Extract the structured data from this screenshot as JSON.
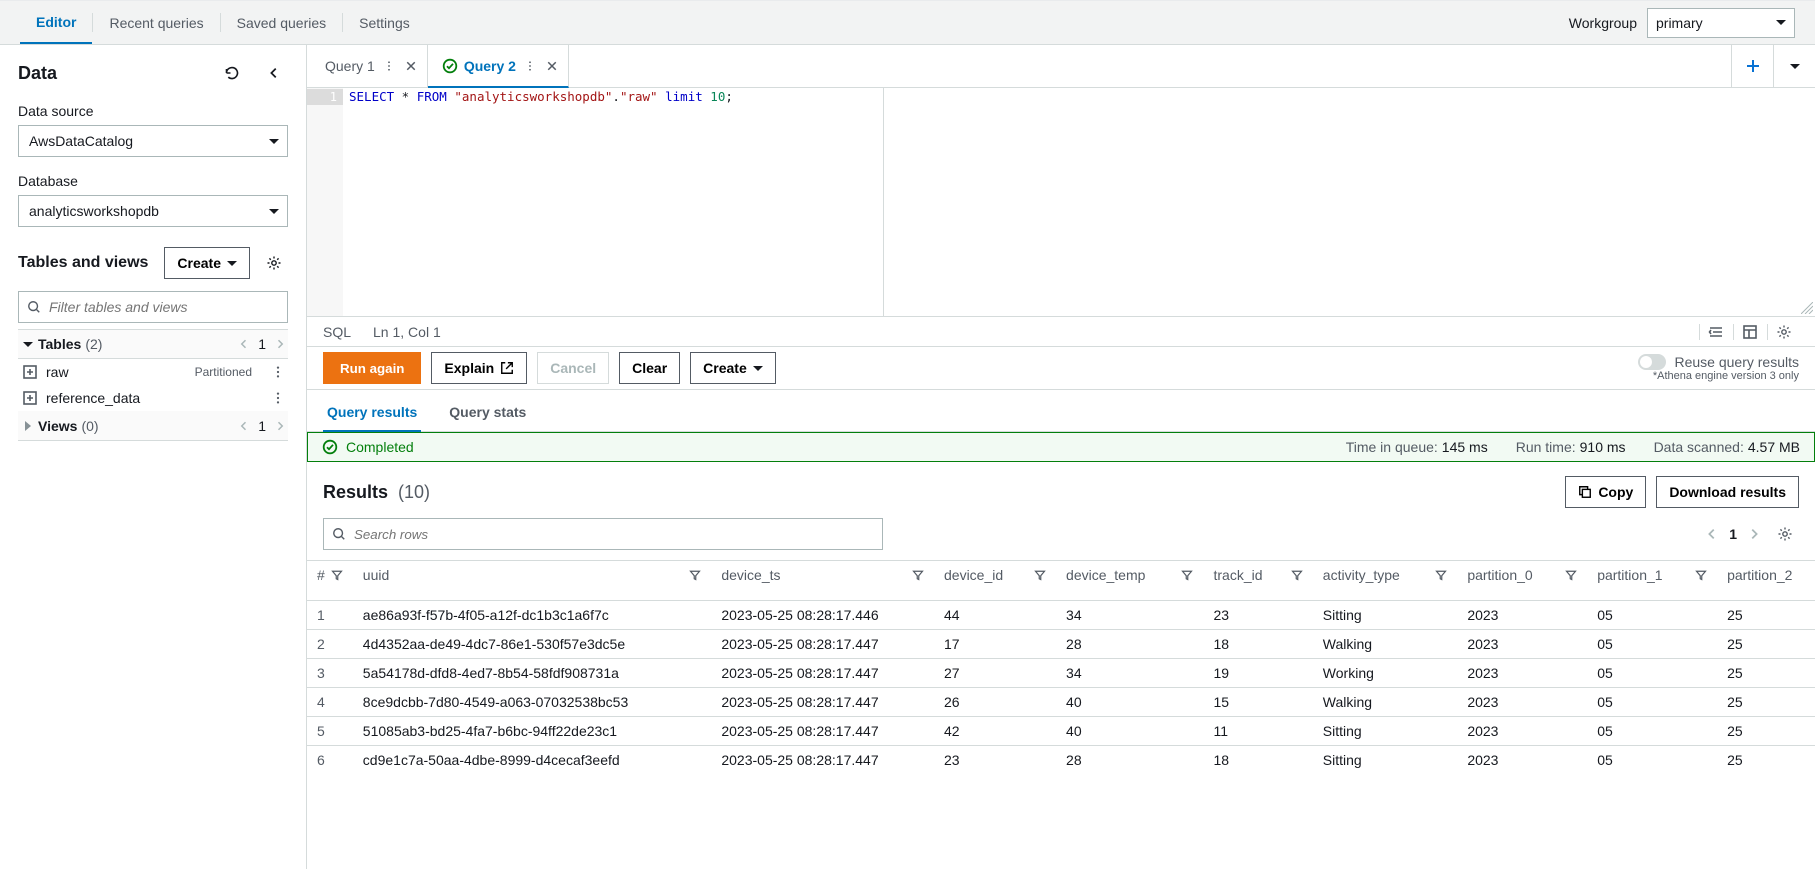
{
  "header": {
    "tabs": [
      "Editor",
      "Recent queries",
      "Saved queries",
      "Settings"
    ],
    "active_tab": 0,
    "workgroup_label": "Workgroup",
    "workgroup_value": "primary"
  },
  "sidebar": {
    "title": "Data",
    "data_source_label": "Data source",
    "data_source_value": "AwsDataCatalog",
    "database_label": "Database",
    "database_value": "analyticsworkshopdb",
    "tables_views_title": "Tables and views",
    "create_btn": "Create",
    "filter_placeholder": "Filter tables and views",
    "tables": {
      "label": "Tables",
      "count": "(2)",
      "page": "1",
      "items": [
        {
          "name": "raw",
          "badge": "Partitioned"
        },
        {
          "name": "reference_data",
          "badge": ""
        }
      ]
    },
    "views": {
      "label": "Views",
      "count": "(0)",
      "page": "1"
    }
  },
  "query_tabs": [
    {
      "label": "Query 1",
      "active": false,
      "status": ""
    },
    {
      "label": "Query 2",
      "active": true,
      "status": "success"
    }
  ],
  "editor": {
    "sql_parts": {
      "kw1": "SELECT",
      "star": " * ",
      "kw2": "FROM",
      "sp1": " ",
      "str1": "\"analyticsworkshopdb\"",
      "dot": ".",
      "str2": "\"raw\"",
      "sp2": " ",
      "kw3": "limit",
      "sp3": " ",
      "num": "10",
      "semi": ";"
    },
    "lang": "SQL",
    "cursor": "Ln 1, Col 1"
  },
  "runbar": {
    "run": "Run again",
    "explain": "Explain",
    "cancel": "Cancel",
    "clear": "Clear",
    "create": "Create",
    "reuse_label": "Reuse query results",
    "note": "*Athena engine version 3 only"
  },
  "result_tabs": {
    "results": "Query results",
    "stats": "Query stats",
    "active": 0
  },
  "alert": {
    "status": "Completed",
    "queue_lbl": "Time in queue:",
    "queue_val": "145 ms",
    "run_lbl": "Run time:",
    "run_val": "910 ms",
    "scan_lbl": "Data scanned:",
    "scan_val": "4.57 MB"
  },
  "results": {
    "title": "Results",
    "count": "(10)",
    "copy_btn": "Copy",
    "download_btn": "Download results",
    "search_placeholder": "Search rows",
    "page": "1",
    "columns": [
      "#",
      "uuid",
      "device_ts",
      "device_id",
      "device_temp",
      "track_id",
      "activity_type",
      "partition_0",
      "partition_1",
      "partition_2"
    ],
    "rows": [
      {
        "idx": "1",
        "uuid": "ae86a93f-f57b-4f05-a12f-dc1b3c1a6f7c",
        "device_ts": "2023-05-25 08:28:17.446",
        "device_id": "44",
        "device_temp": "34",
        "track_id": "23",
        "activity_type": "Sitting",
        "partition_0": "2023",
        "partition_1": "05",
        "partition_2": "25"
      },
      {
        "idx": "2",
        "uuid": "4d4352aa-de49-4dc7-86e1-530f57e3dc5e",
        "device_ts": "2023-05-25 08:28:17.447",
        "device_id": "17",
        "device_temp": "28",
        "track_id": "18",
        "activity_type": "Walking",
        "partition_0": "2023",
        "partition_1": "05",
        "partition_2": "25"
      },
      {
        "idx": "3",
        "uuid": "5a54178d-dfd8-4ed7-8b54-58fdf908731a",
        "device_ts": "2023-05-25 08:28:17.447",
        "device_id": "27",
        "device_temp": "34",
        "track_id": "19",
        "activity_type": "Working",
        "partition_0": "2023",
        "partition_1": "05",
        "partition_2": "25"
      },
      {
        "idx": "4",
        "uuid": "8ce9dcbb-7d80-4549-a063-07032538bc53",
        "device_ts": "2023-05-25 08:28:17.447",
        "device_id": "26",
        "device_temp": "40",
        "track_id": "15",
        "activity_type": "Walking",
        "partition_0": "2023",
        "partition_1": "05",
        "partition_2": "25"
      },
      {
        "idx": "5",
        "uuid": "51085ab3-bd25-4fa7-b6bc-94ff22de23c1",
        "device_ts": "2023-05-25 08:28:17.447",
        "device_id": "42",
        "device_temp": "40",
        "track_id": "11",
        "activity_type": "Sitting",
        "partition_0": "2023",
        "partition_1": "05",
        "partition_2": "25"
      },
      {
        "idx": "6",
        "uuid": "cd9e1c7a-50aa-4dbe-8999-d4cecaf3eefd",
        "device_ts": "2023-05-25 08:28:17.447",
        "device_id": "23",
        "device_temp": "28",
        "track_id": "18",
        "activity_type": "Sitting",
        "partition_0": "2023",
        "partition_1": "05",
        "partition_2": "25"
      }
    ]
  }
}
